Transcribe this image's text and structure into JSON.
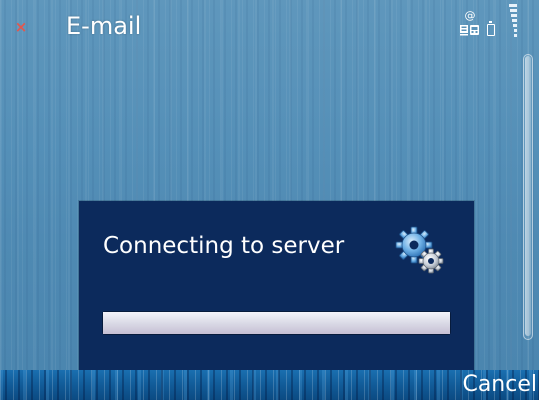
{
  "title_bar": {
    "close_glyph": "×",
    "title": "E-mail",
    "close_color": "#e0584f"
  },
  "status": {
    "email_indicator_icon": "email-indicator-icon",
    "battery_icon": "battery-icon",
    "signal_icon": "signal-strength-icon"
  },
  "dialog": {
    "message": "Connecting to server",
    "icon": "gears-icon",
    "background_color": "#0c2a5c",
    "progress_fraction": 1.0
  },
  "softkeys": {
    "right_label": "Cancel"
  }
}
